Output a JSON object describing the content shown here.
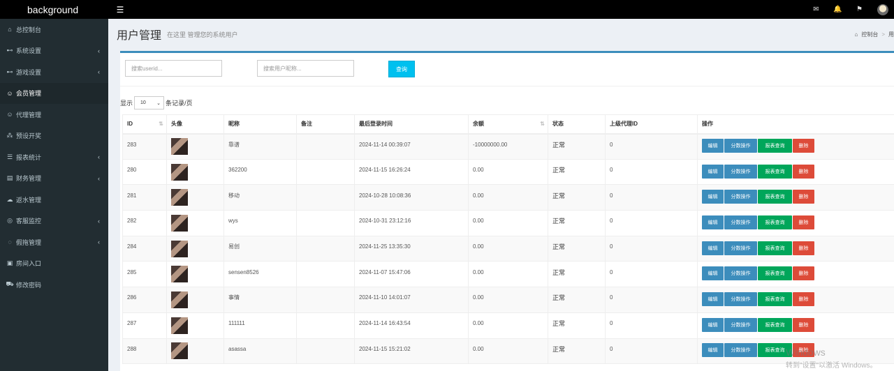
{
  "header": {
    "brand": "background",
    "menu_icon": "hamburger-icon",
    "icons": [
      "mail-icon",
      "bell-icon",
      "flag-icon"
    ]
  },
  "sidebar": {
    "items": [
      {
        "label": "总控制台",
        "icon": "dashboard-icon",
        "glyph": "⌂",
        "has_chevron": false
      },
      {
        "label": "系统设置",
        "icon": "gamepad-icon",
        "glyph": "⊷",
        "has_chevron": true
      },
      {
        "label": "游戏设置",
        "icon": "gamepad-icon",
        "glyph": "⊷",
        "has_chevron": true
      },
      {
        "label": "会员管理",
        "icon": "users-icon",
        "glyph": "☺",
        "has_chevron": false,
        "active": true
      },
      {
        "label": "代理管理",
        "icon": "users-icon",
        "glyph": "☺",
        "has_chevron": false
      },
      {
        "label": "预设开奖",
        "icon": "share-icon",
        "glyph": "⁂",
        "has_chevron": false
      },
      {
        "label": "报表统计",
        "icon": "list-icon",
        "glyph": "☰",
        "has_chevron": true
      },
      {
        "label": "财务管理",
        "icon": "book-icon",
        "glyph": "▤",
        "has_chevron": true
      },
      {
        "label": "返水管理",
        "icon": "cloud-icon",
        "glyph": "☁",
        "has_chevron": false
      },
      {
        "label": "客服监控",
        "icon": "chat-icon",
        "glyph": "◎",
        "has_chevron": true
      },
      {
        "label": "假拖管理",
        "icon": "comment-icon",
        "glyph": "◌",
        "has_chevron": true
      },
      {
        "label": "房间入口",
        "icon": "edit-icon",
        "glyph": "▣",
        "has_chevron": false
      },
      {
        "label": "修改密码",
        "icon": "cart-icon",
        "glyph": "⛟",
        "has_chevron": false
      }
    ]
  },
  "page": {
    "title": "用户管理",
    "subtitle": "在这里 管理您的系统用户",
    "breadcrumb_home": "控制台",
    "breadcrumb_current": "用"
  },
  "search": {
    "userid_placeholder": "搜索userid...",
    "nickname_placeholder": "搜索用户昵称...",
    "button_label": "查询"
  },
  "length": {
    "prefix": "显示",
    "value": "10",
    "suffix": "条记录/页"
  },
  "table": {
    "columns": [
      "ID",
      "头像",
      "昵称",
      "备注",
      "最后登录时间",
      "余额",
      "状态",
      "上级代理ID",
      "操作"
    ],
    "actions": {
      "edit": "编辑",
      "score": "分数操作",
      "report": "报表查询",
      "delete": "删除"
    },
    "rows": [
      {
        "id": "283",
        "nickname": "靠谱",
        "note": "",
        "last_login": "2024-11-14 00:39:07",
        "balance": "-10000000.00",
        "status": "正常",
        "parent_id": "0"
      },
      {
        "id": "280",
        "nickname": "362200",
        "note": "",
        "last_login": "2024-11-15 16:26:24",
        "balance": "0.00",
        "status": "正常",
        "parent_id": "0"
      },
      {
        "id": "281",
        "nickname": "移动",
        "note": "",
        "last_login": "2024-10-28 10:08:36",
        "balance": "0.00",
        "status": "正常",
        "parent_id": "0"
      },
      {
        "id": "282",
        "nickname": "wys",
        "note": "",
        "last_login": "2024-10-31 23:12:16",
        "balance": "0.00",
        "status": "正常",
        "parent_id": "0"
      },
      {
        "id": "284",
        "nickname": "易创",
        "note": "",
        "last_login": "2024-11-25 13:35:30",
        "balance": "0.00",
        "status": "正常",
        "parent_id": "0"
      },
      {
        "id": "285",
        "nickname": "sensen8526",
        "note": "",
        "last_login": "2024-11-07 15:47:06",
        "balance": "0.00",
        "status": "正常",
        "parent_id": "0"
      },
      {
        "id": "286",
        "nickname": "事情",
        "note": "",
        "last_login": "2024-11-10 14:01:07",
        "balance": "0.00",
        "status": "正常",
        "parent_id": "0"
      },
      {
        "id": "287",
        "nickname": "111111",
        "note": "",
        "last_login": "2024-11-14 16:43:54",
        "balance": "0.00",
        "status": "正常",
        "parent_id": "0"
      },
      {
        "id": "288",
        "nickname": "asassa",
        "note": "",
        "last_login": "2024-11-15 15:21:02",
        "balance": "0.00",
        "status": "正常",
        "parent_id": "0"
      }
    ]
  },
  "watermark": {
    "line1": "Windows",
    "line2": "转到\"设置\"以激活 Windows。"
  }
}
